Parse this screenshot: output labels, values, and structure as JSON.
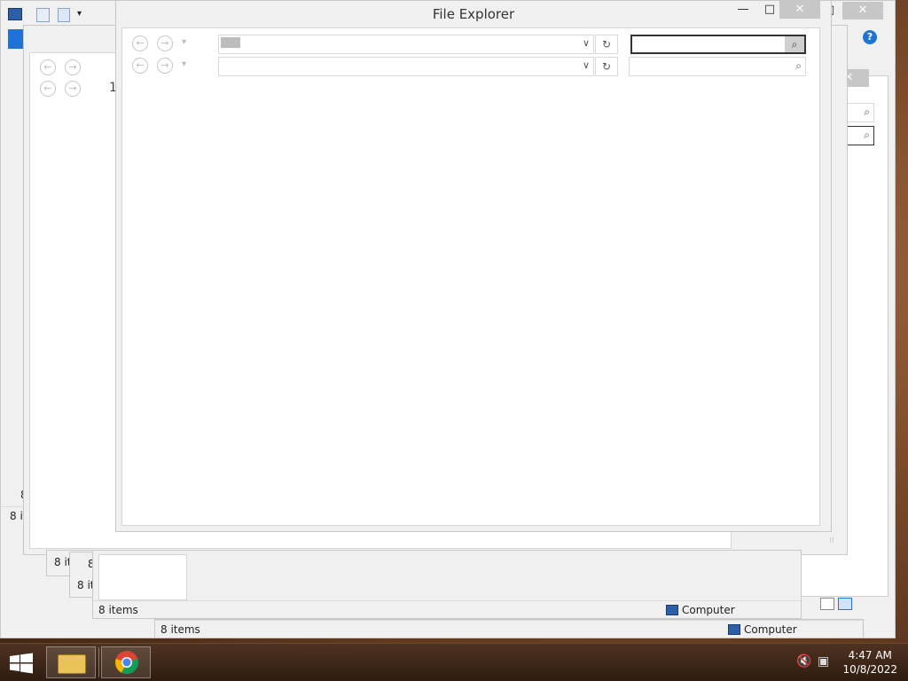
{
  "main_window": {
    "title": "File Explorer",
    "minimize_glyph": "—",
    "maximize_glyph": "□",
    "close_glyph": "✕"
  },
  "bg_windows": {
    "status_items_short": "8 it",
    "status_items_full": "8 items",
    "computer_label": "Computer",
    "partial_digit": "1",
    "partial_digit_2": "8"
  },
  "nav": {
    "back_glyph": "←",
    "forward_glyph": "→",
    "dropdown_glyph": "▾",
    "refresh_glyph": "↻",
    "search_glyph": "⌕",
    "address_chevron": "∨"
  },
  "help": {
    "glyph": "?"
  },
  "taskbar": {
    "time": "4:47 AM",
    "date": "10/8/2022"
  },
  "colors": {
    "accent_blue": "#1e73d6",
    "taskbar": "#3b2416"
  }
}
